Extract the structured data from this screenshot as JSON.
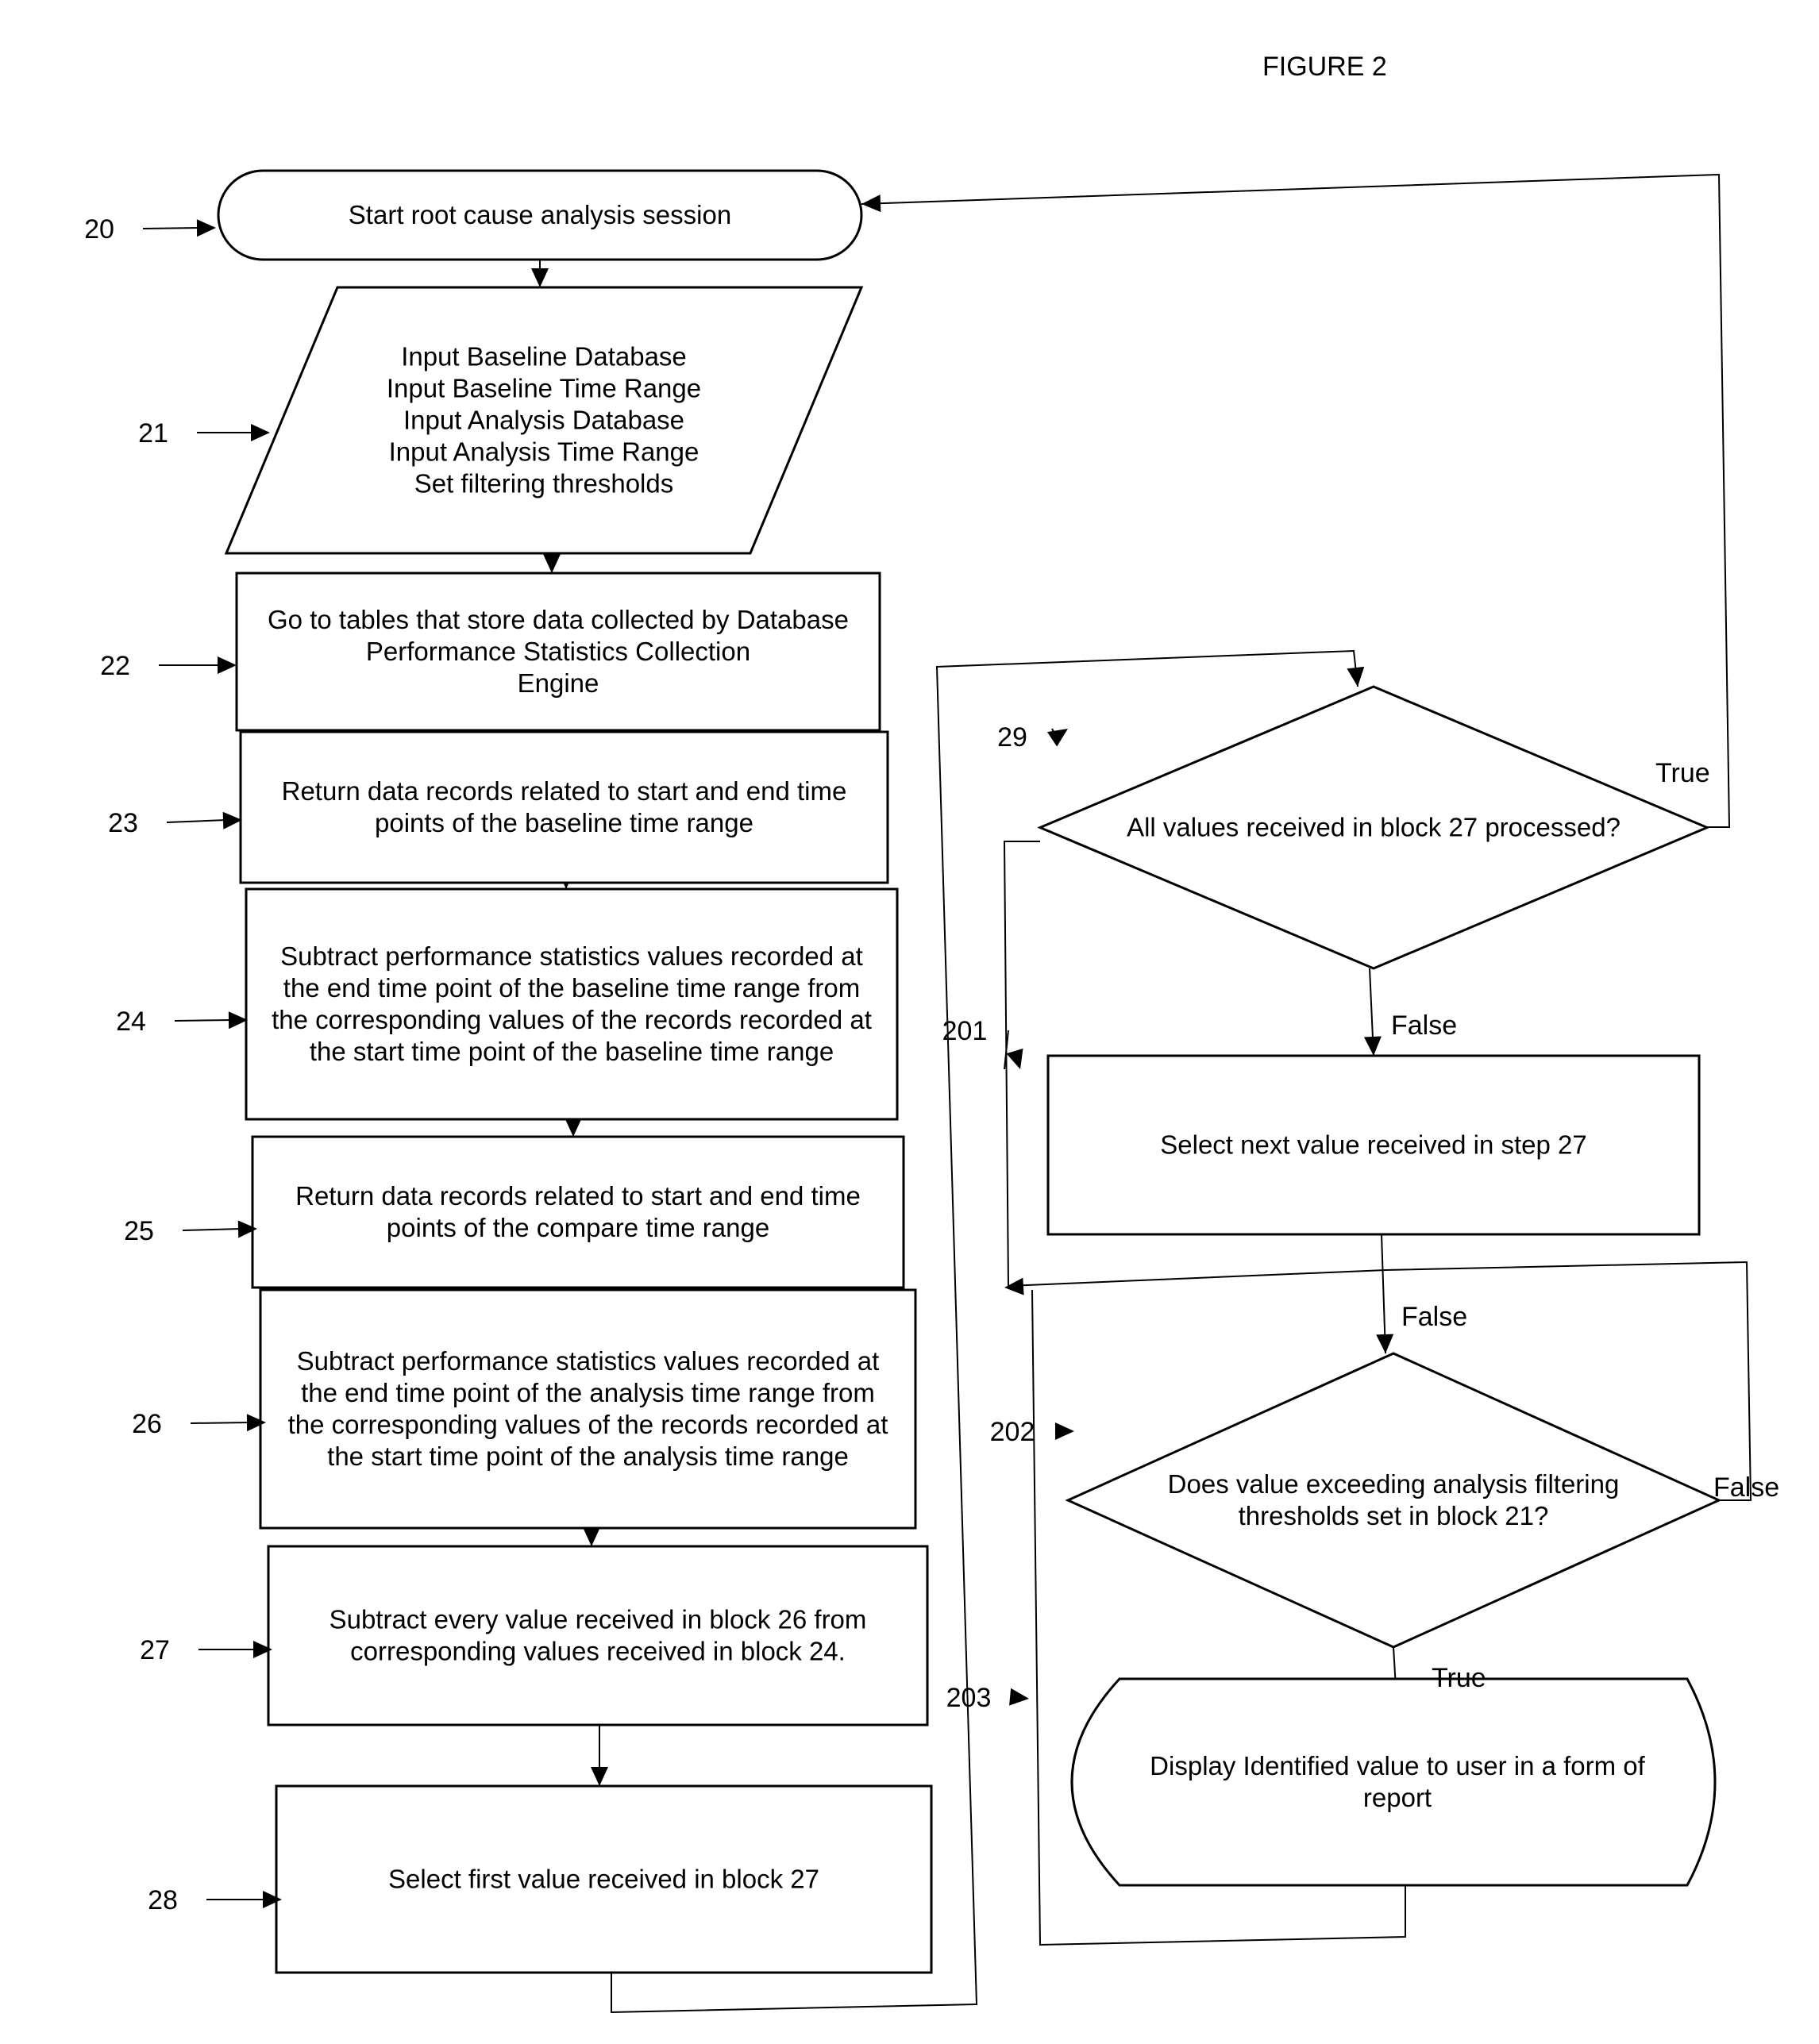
{
  "figure": {
    "title": "FIGURE 2"
  },
  "nodes": [
    {
      "id": "20",
      "ref": "20",
      "shape": "terminator",
      "lines": [
        "Start root cause analysis session"
      ]
    },
    {
      "id": "21",
      "ref": "21",
      "shape": "parallelogram",
      "lines": [
        "Input Baseline Database",
        "Input Baseline Time Range",
        "Input Analysis Database",
        "Input Analysis Time Range",
        "Set filtering thresholds"
      ]
    },
    {
      "id": "22",
      "ref": "22",
      "shape": "process",
      "lines": [
        "Go to tables that store data collected by Database",
        "Performance Statistics Collection",
        "Engine"
      ]
    },
    {
      "id": "23",
      "ref": "23",
      "shape": "process",
      "lines": [
        "Return data records related to start and end time",
        "points of the baseline time range"
      ]
    },
    {
      "id": "24",
      "ref": "24",
      "shape": "process",
      "lines": [
        "Subtract performance statistics values recorded at",
        "the end time point of the baseline time range from",
        "the corresponding values of the records recorded at",
        "the start time point of the baseline time range"
      ]
    },
    {
      "id": "25",
      "ref": "25",
      "shape": "process",
      "lines": [
        "Return data records related to start and end time",
        "points of the compare time range"
      ]
    },
    {
      "id": "26",
      "ref": "26",
      "shape": "process",
      "lines": [
        "Subtract performance statistics values recorded at",
        "the end time point of the analysis time range from",
        "the corresponding values of the records recorded at",
        "the start time point of the analysis time range"
      ]
    },
    {
      "id": "27",
      "ref": "27",
      "shape": "process",
      "lines": [
        "Subtract every value received in block 26 from",
        "corresponding values received in block 24."
      ]
    },
    {
      "id": "28",
      "ref": "28",
      "shape": "process",
      "lines": [
        "Select first value received in block 27"
      ]
    },
    {
      "id": "29",
      "ref": "29",
      "shape": "decision",
      "lines": [
        "All values received in block 27 processed?"
      ]
    },
    {
      "id": "201",
      "ref": "201",
      "shape": "process",
      "lines": [
        "Select next value received in step 27"
      ]
    },
    {
      "id": "202",
      "ref": "202",
      "shape": "decision",
      "lines": [
        "Does value exceeding analysis filtering",
        "thresholds set in block  21?"
      ]
    },
    {
      "id": "203",
      "ref": "203",
      "shape": "display",
      "lines": [
        "Display Identified value to user in a form of",
        "report"
      ]
    }
  ],
  "edges": [
    {
      "from": "20",
      "to": "21",
      "label": ""
    },
    {
      "from": "21",
      "to": "22",
      "label": ""
    },
    {
      "from": "22",
      "to": "23",
      "label": ""
    },
    {
      "from": "23",
      "to": "24",
      "label": ""
    },
    {
      "from": "24",
      "to": "25",
      "label": ""
    },
    {
      "from": "25",
      "to": "26",
      "label": ""
    },
    {
      "from": "26",
      "to": "27",
      "label": ""
    },
    {
      "from": "27",
      "to": "28",
      "label": ""
    },
    {
      "from": "28",
      "to": "29",
      "label": ""
    },
    {
      "from": "29",
      "to": "20",
      "label": "True"
    },
    {
      "from": "29",
      "to": "201",
      "label": "False"
    },
    {
      "from": "201",
      "to": "202",
      "label": "False"
    },
    {
      "from": "202",
      "to": "29",
      "label": "False"
    },
    {
      "from": "202",
      "to": "203",
      "label": "True"
    },
    {
      "from": "203",
      "to": "29",
      "label": ""
    }
  ]
}
